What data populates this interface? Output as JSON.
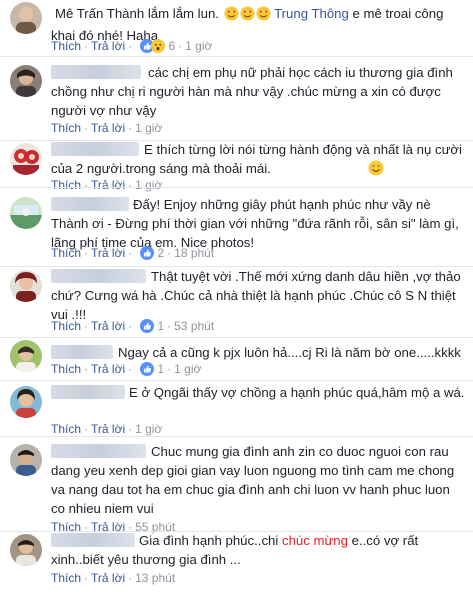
{
  "actions": {
    "like": "Thích",
    "reply": "Trả lời",
    "sep": "·"
  },
  "comments": [
    {
      "text": "Mê Trấn Thành lắm lắm lun.",
      "tag": "Trung Thông",
      "text2": " e mê troai công khai đó nhé! Haha",
      "reaction_count": "6",
      "time": "1 giờ"
    },
    {
      "text": "các chị em phụ nữ phải học cách iu thương gia đình chồng như chị ri người hàn mà như vậy .chúc mừng a xin có được người vợ như vậy",
      "time": "1 giờ"
    },
    {
      "text": "E thích từng lời nói từng hành động và nhất là nụ cười của 2 người.trong sáng mà thoải mái.",
      "time": "1 giờ"
    },
    {
      "text": "Đấy! Enjoy những giây phút hạnh phúc như vầy nè Thành ơi - Đừng phí thời gian với những \"đứa rãnh rỗi, sân si\" làm gì, lãng phí time của em. Nice photos!",
      "reaction_count": "2",
      "time": "18 phút"
    },
    {
      "text": "Thật tuyệt vời .Thế mới xứng danh dâu hiền ,vợ thảo chứ? Cưng wá hà .Chúc cả nhà thiệt là hạnh phúc .Chúc cô S N thiệt vui .!!!",
      "reaction_count": "1",
      "time": "53 phút"
    },
    {
      "text": "Ngay cả a cũng k pjx luôn hả....cj Ri là năm bờ one.....kkkk",
      "reaction_count": "1",
      "time": "1 giờ"
    },
    {
      "text": "E ở Qngãi thấy vợ chồng a hạnh phúc quá,hâm mộ a wá.",
      "time": "1 giờ"
    },
    {
      "text": "Chuc mung gia đình anh zin co duoc nguoi con rau dang yeu xenh dep gioi gian vay luon nguong mo tình cam me chong va nang dau tot ha em chuc gia đình anh chi luon vv hanh phuc luon co nhieu niem vui",
      "time": "55 phút"
    },
    {
      "text": "Gia đình hạnh phúc..chi ",
      "text_red": "chúc mừng",
      "text3": " e..có vợ rất xinh..biết yêu thương gia đình ...",
      "time": "13 phút"
    }
  ]
}
